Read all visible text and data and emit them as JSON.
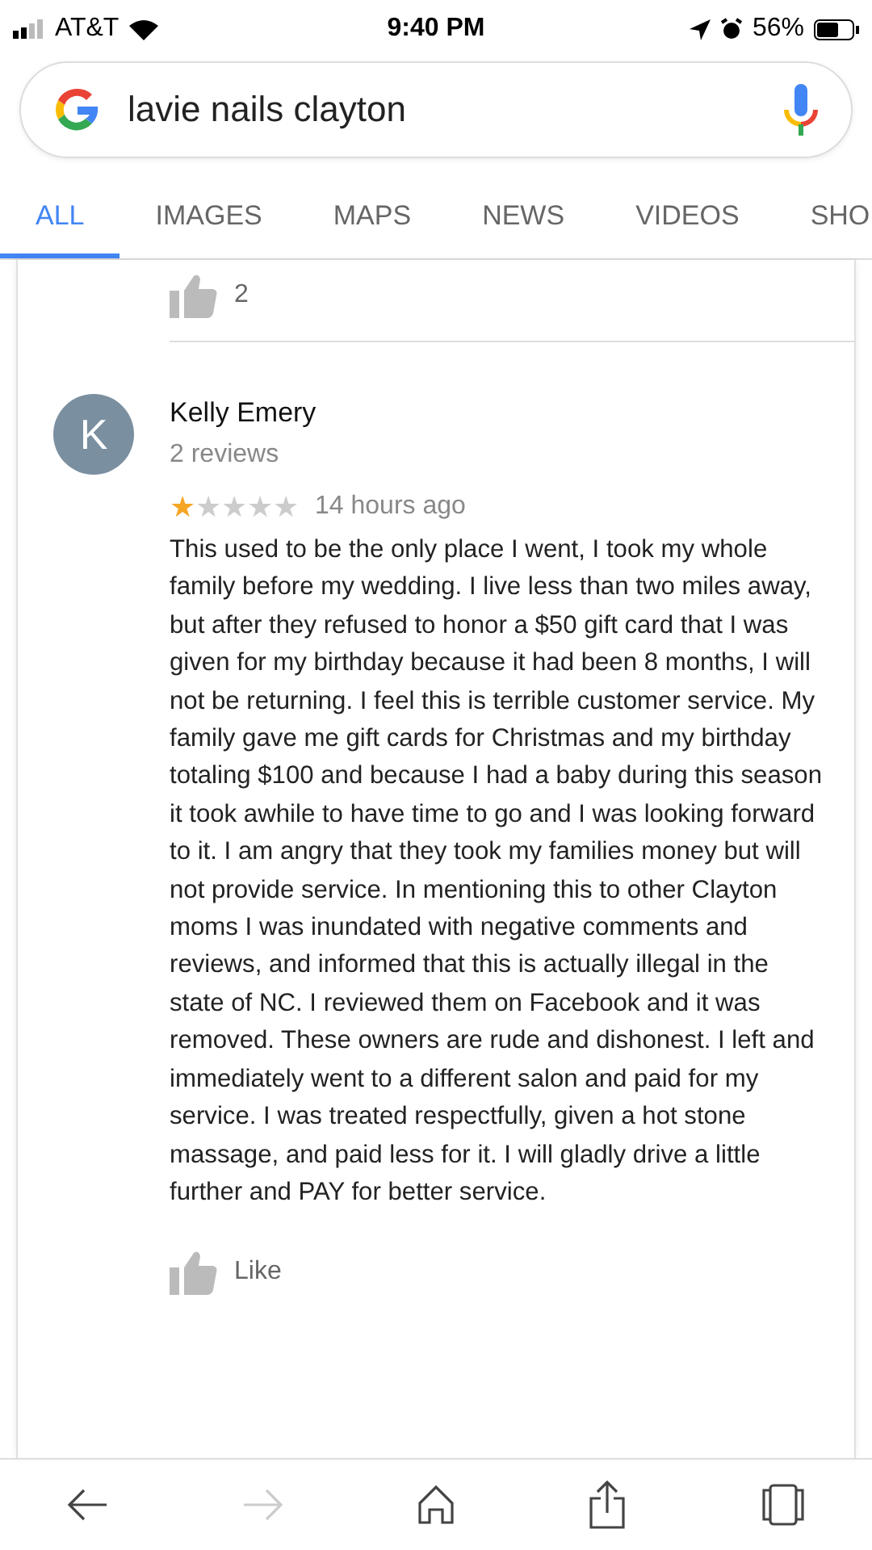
{
  "status_bar": {
    "carrier": "AT&T",
    "time": "9:40 PM",
    "battery": "56%"
  },
  "search": {
    "value": "lavie nails clayton"
  },
  "tabs": [
    {
      "label": "ALL",
      "selected": true
    },
    {
      "label": "IMAGES",
      "selected": false
    },
    {
      "label": "MAPS",
      "selected": false
    },
    {
      "label": "NEWS",
      "selected": false
    },
    {
      "label": "VIDEOS",
      "selected": false
    },
    {
      "label": "SHO",
      "selected": false
    }
  ],
  "previous_review": {
    "likes": "2"
  },
  "review": {
    "avatar_letter": "K",
    "name": "Kelly Emery",
    "review_count": "2 reviews",
    "stars": 1,
    "time": "14 hours ago",
    "text": "This used to be the only place I went, I took my whole family before my wedding. I live less than two miles away, but after they refused to honor a $50 gift card that I was given for my birthday because it had been 8 months, I will not be returning. I feel this is terrible customer service. My family gave me gift cards for Christmas and my birthday totaling $100 and because I had a baby during this season it took awhile to have time to go and I was looking forward to it. I am angry that they took my families money but will not provide service. In mentioning this to other Clayton moms I was inundated with negative comments and reviews, and informed that this is actually illegal in the state of NC. I reviewed them on Facebook and it was removed. These owners are rude and dishonest. I left and immediately went to a different salon and paid for my service. I was treated respectfully, given a hot stone massage, and paid less for it. I will gladly drive a little further and PAY for better service.",
    "like_label": "Like"
  },
  "toolbar": [
    {
      "kind": "back",
      "disabled": false
    },
    {
      "kind": "forward",
      "disabled": true
    },
    {
      "kind": "home",
      "disabled": false
    },
    {
      "kind": "share",
      "disabled": false
    },
    {
      "kind": "tabs",
      "disabled": false
    }
  ]
}
